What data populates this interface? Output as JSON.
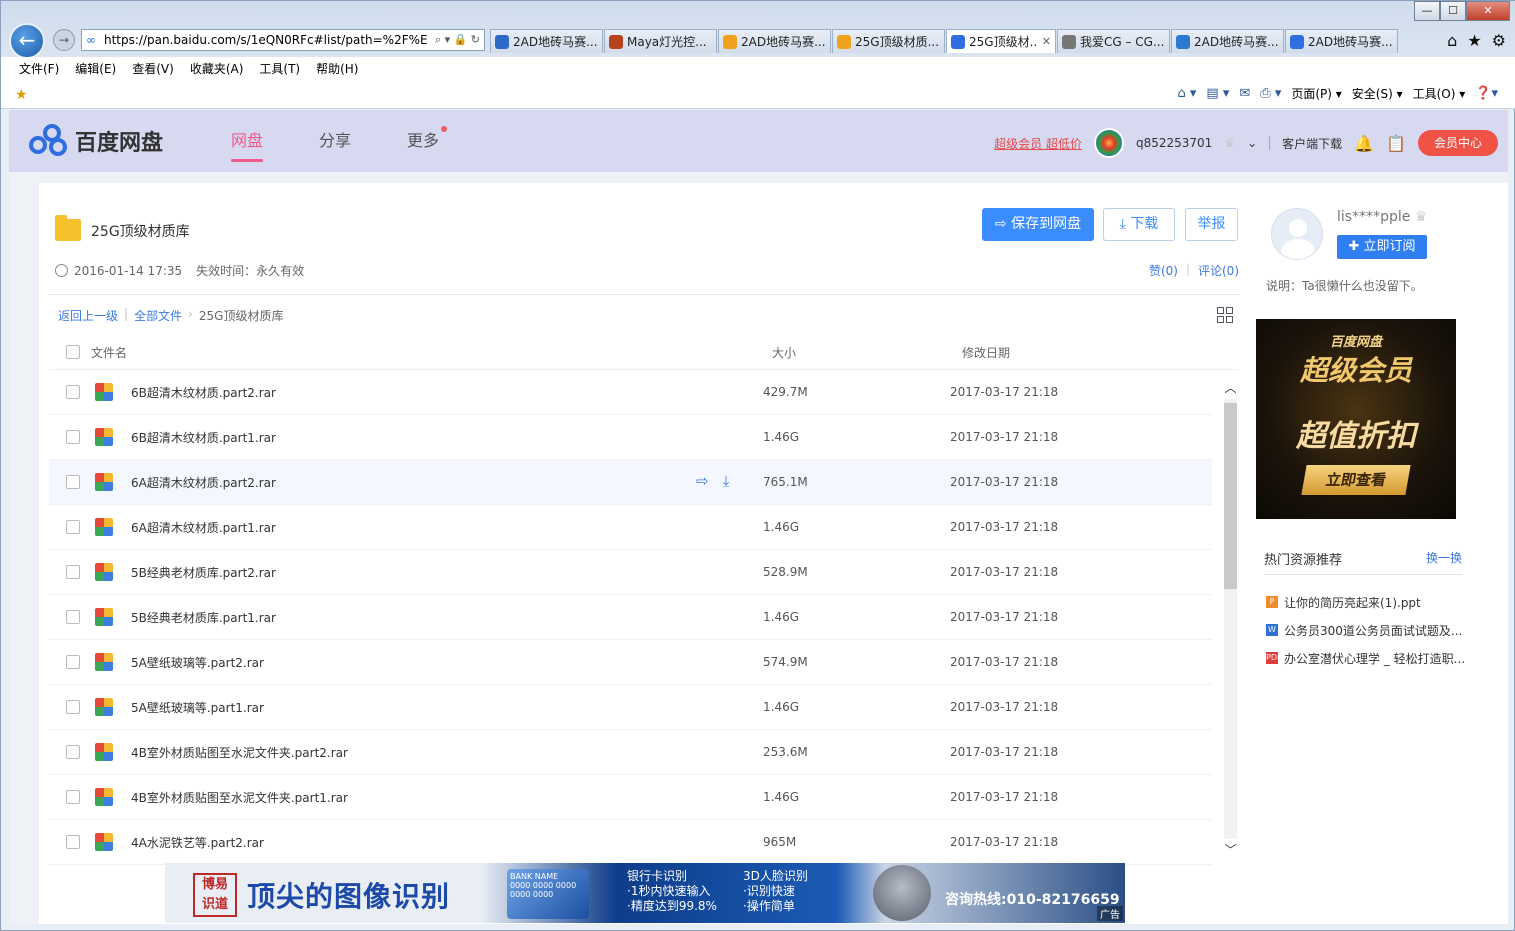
{
  "browser": {
    "window_controls": [
      "—",
      "☐",
      "✕"
    ],
    "url": "https://pan.baidu.com/s/1eQN0RFc#list/path=%2F%E",
    "address_tools": "⌕ ▾ 🔒 ↻",
    "tabs": [
      {
        "label": "2AD地砖马赛...",
        "color": "#2e6ac8",
        "active": false,
        "closable": false
      },
      {
        "label": "Maya灯光控...",
        "color": "#b5431b",
        "active": false,
        "closable": false
      },
      {
        "label": "2AD地砖马赛...",
        "color": "#f0a21f",
        "active": false,
        "closable": false
      },
      {
        "label": "25G顶级材质...",
        "color": "#f0a21f",
        "active": false,
        "closable": false
      },
      {
        "label": "25G顶级材...",
        "color": "#2f6de0",
        "active": true,
        "closable": true
      },
      {
        "label": "我爱CG – CG...",
        "color": "#777777",
        "active": false,
        "closable": false
      },
      {
        "label": "2AD地砖马赛...",
        "color": "#2b7ad0",
        "active": false,
        "closable": false
      },
      {
        "label": "2AD地砖马赛...",
        "color": "#2f6de0",
        "active": false,
        "closable": false
      }
    ],
    "tab_close": "✕",
    "menu": [
      "文件(F)",
      "编辑(E)",
      "查看(V)",
      "收藏夹(A)",
      "工具(T)",
      "帮助(H)"
    ],
    "command_bar": [
      "页面(P) ▾",
      "安全(S) ▾",
      "工具(O) ▾"
    ]
  },
  "site": {
    "logo_text": "百度网盘",
    "nav": [
      {
        "label": "网盘",
        "active": true
      },
      {
        "label": "分享",
        "active": false
      },
      {
        "label": "更多",
        "active": false,
        "dot": true
      }
    ],
    "vip_promo": "超级会员 超低价",
    "username": "q852253701",
    "client_download": "客户端下载",
    "member_center": "会员中心"
  },
  "share": {
    "folder_title": "25G顶级材质库",
    "save_button": "保存到网盘",
    "download_button": "下载",
    "report_button": "举报",
    "created": "2016-01-14 17:35",
    "expiry": "失效时间：永久有效",
    "likes": "赞(0)",
    "comments": "评论(0)",
    "breadcrumb": {
      "back": "返回上一级",
      "all": "全部文件",
      "current": "25G顶级材质库"
    },
    "columns": {
      "name": "文件名",
      "size": "大小",
      "modified": "修改日期"
    },
    "files": [
      {
        "name": "6B超清木纹材质.part2.rar",
        "size": "429.7M",
        "modified": "2017-03-17 21:18"
      },
      {
        "name": "6B超清木纹材质.part1.rar",
        "size": "1.46G",
        "modified": "2017-03-17 21:18"
      },
      {
        "name": "6A超清木纹材质.part2.rar",
        "size": "765.1M",
        "modified": "2017-03-17 21:18",
        "hover": true
      },
      {
        "name": "6A超清木纹材质.part1.rar",
        "size": "1.46G",
        "modified": "2017-03-17 21:18"
      },
      {
        "name": "5B经典老材质库.part2.rar",
        "size": "528.9M",
        "modified": "2017-03-17 21:18"
      },
      {
        "name": "5B经典老材质库.part1.rar",
        "size": "1.46G",
        "modified": "2017-03-17 21:18"
      },
      {
        "name": "5A壁纸玻璃等.part2.rar",
        "size": "574.9M",
        "modified": "2017-03-17 21:18"
      },
      {
        "name": "5A壁纸玻璃等.part1.rar",
        "size": "1.46G",
        "modified": "2017-03-17 21:18"
      },
      {
        "name": "4B室外材质贴图至水泥文件夹.part2.rar",
        "size": "253.6M",
        "modified": "2017-03-17 21:18"
      },
      {
        "name": "4B室外材质贴图至水泥文件夹.part1.rar",
        "size": "1.46G",
        "modified": "2017-03-17 21:18"
      },
      {
        "name": "4A水泥铁艺等.part2.rar",
        "size": "965M",
        "modified": "2017-03-17 21:18"
      }
    ]
  },
  "ad_banner": {
    "seal": "博易\n识道",
    "headline": "顶尖的图像识别",
    "card_text": "BANK NAME\n0000 0000 0000\n0000 0000",
    "col1": "银行卡识别\n·1秒内快速输入\n·精度达到99.8%",
    "col2": "3D人脸识别\n·识别快速\n·操作简单",
    "hotline": "咨询热线:010-82176659",
    "ad_tag": "广告"
  },
  "sidebar": {
    "user": "lis****pple",
    "subscribe": "立即订阅",
    "desc": "说明：Ta很懒什么也没留下。",
    "vip_ad": {
      "brand": "百度网盘",
      "title": "超级会员",
      "slogan": "超值折扣",
      "cta": "立即查看"
    },
    "hot_title": "热门资源推荐",
    "hot_more": "换一换",
    "hot_items": [
      {
        "label": "让你的简历亮起来(1).ppt",
        "type": "P",
        "color": "#f28b2e"
      },
      {
        "label": "公务员300道公务员面试试题及...",
        "type": "W",
        "color": "#2f6fd6"
      },
      {
        "label": "办公室潜伏心理学 _ 轻松打造职...",
        "type": "PDF",
        "color": "#e23b3b"
      }
    ]
  }
}
